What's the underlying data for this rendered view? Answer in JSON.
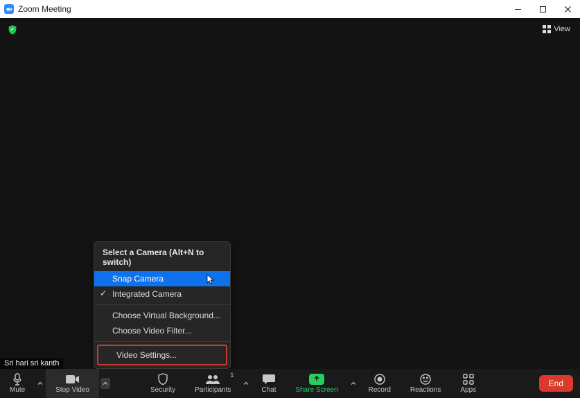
{
  "titlebar": {
    "title": "Zoom Meeting"
  },
  "view": {
    "label": "View"
  },
  "participant_name": "Sri hari sri kanth",
  "camera_menu": {
    "header": "Select a Camera (Alt+N to switch)",
    "items": [
      {
        "label": "Snap Camera",
        "checked": false,
        "highlight": true
      },
      {
        "label": "Integrated Camera",
        "checked": true,
        "highlight": false
      }
    ],
    "bg_label": "Choose Virtual Background...",
    "filter_label": "Choose Video Filter...",
    "settings_label": "Video Settings..."
  },
  "toolbar": {
    "mute": "Mute",
    "stop_video": "Stop Video",
    "security": "Security",
    "participants": "Participants",
    "participants_count": "1",
    "chat": "Chat",
    "share_screen": "Share Screen",
    "record": "Record",
    "reactions": "Reactions",
    "apps": "Apps",
    "end": "End"
  }
}
